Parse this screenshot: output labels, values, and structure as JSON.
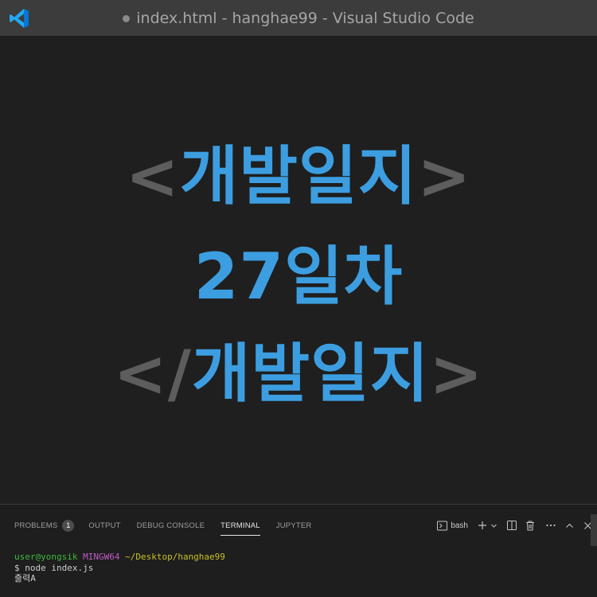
{
  "window": {
    "title": "index.html - hanghae99 - Visual Studio Code",
    "logo_icon": "vscode-logo-icon",
    "accent": "#0078d4"
  },
  "editor": {
    "line1": {
      "open": "<",
      "word": "개발일지",
      "close": ">"
    },
    "line2": {
      "word": "27일차"
    },
    "line3": {
      "open": "</",
      "word": "개발일지",
      "close": ">"
    },
    "tag_color": "#5d5d5d",
    "keyword_color": "#3c9ee0"
  },
  "panel": {
    "tabs": [
      {
        "label": "PROBLEMS",
        "badge": "1"
      },
      {
        "label": "OUTPUT"
      },
      {
        "label": "DEBUG CONSOLE"
      },
      {
        "label": "TERMINAL",
        "active": true
      },
      {
        "label": "JUPYTER"
      }
    ],
    "terminal_profile": "bash",
    "actions": [
      "terminal-icon",
      "plus-icon",
      "chevron-down-icon",
      "split-icon",
      "trash-icon",
      "more-icon",
      "chevron-up-icon",
      "close-icon"
    ]
  },
  "terminal": {
    "user": "user@yongsik",
    "host": "MINGW64",
    "path": "~/Desktop/hanghae99",
    "command": "$ node index.js",
    "output": "출력A"
  }
}
